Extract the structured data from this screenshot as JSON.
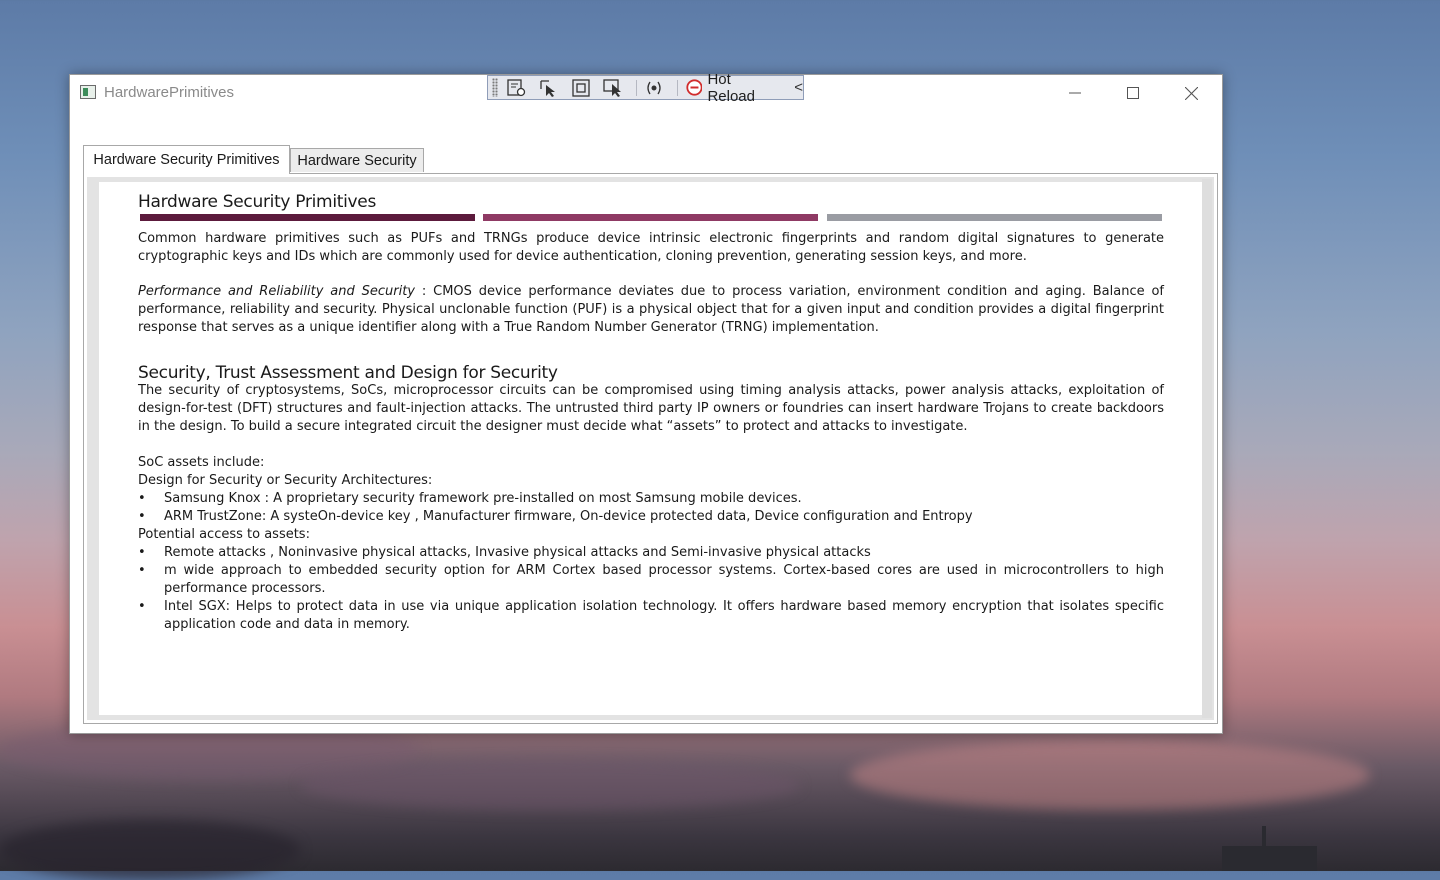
{
  "window": {
    "title": "HardwarePrimitives"
  },
  "devbar": {
    "hot_reload_label": "Hot Reload",
    "collapse_glyph": "<",
    "tools": [
      "select-element-icon",
      "display-layout-adorners-icon",
      "track-focused-element-icon",
      "binding-failures-icon"
    ]
  },
  "tabs": [
    {
      "label": "Hardware Security Primitives",
      "active": true
    },
    {
      "label": "Hardware Security",
      "active": false
    }
  ],
  "content": {
    "heading1": "Hardware Security Primitives",
    "bar_colors": [
      "#5c1a3c",
      "#8f3a64",
      "#9a9ca3"
    ],
    "intro": "Common hardware primitives such as PUFs and TRNGs produce device intrinsic electronic fingerprints and random digital signatures to generate cryptographic keys and IDs which are commonly used for device authentication, cloning prevention, generating session keys, and more.",
    "perf_italic": "Performance and Reliability and Security",
    "perf_text": " : CMOS device performance deviates due to process variation, environment condition and aging.  Balance of performance, reliability and security.  Physical unclonable function (PUF) is a physical object that for a given input and condition provides a digital fingerprint response that serves as a unique identifier along with a True Random Number Generator (TRNG) implementation.",
    "heading2": "Security, Trust Assessment and Design for Security",
    "security_text": " The security of cryptosystems, SoCs, microprocessor circuits can be compromised using timing analysis attacks, power analysis attacks, exploitation of design-for-test (DFT) structures and fault-injection attacks.  The untrusted third party IP owners or foundries can insert hardware Trojans to create backdoors in the design.   To build a secure integrated circuit the designer must decide what “assets” to protect and attacks to investigate.",
    "soc_assets": "SoC assets include:",
    "design_for_security": "Design for Security or Security Architectures:",
    "bullet_glyph": "•",
    "arch_items": [
      "Samsung Knox : A proprietary security framework pre-installed on most Samsung mobile devices.",
      "ARM TrustZone: A systeOn-device key , Manufacturer firmware, On-device protected data, Device configuration and Entropy"
    ],
    "potential_access": "Potential access to assets:",
    "access_items": [
      "Remote attacks , Noninvasive physical attacks, Invasive physical attacks and Semi-invasive physical attacks",
      "m wide approach to embedded security option for ARM Cortex based processor systems. Cortex-based cores are used in microcontrollers to high performance processors.",
      "Intel SGX: Helps to protect data in use via unique application isolation technology. It offers hardware based memory encryption that isolates specific application code and data in memory."
    ]
  }
}
